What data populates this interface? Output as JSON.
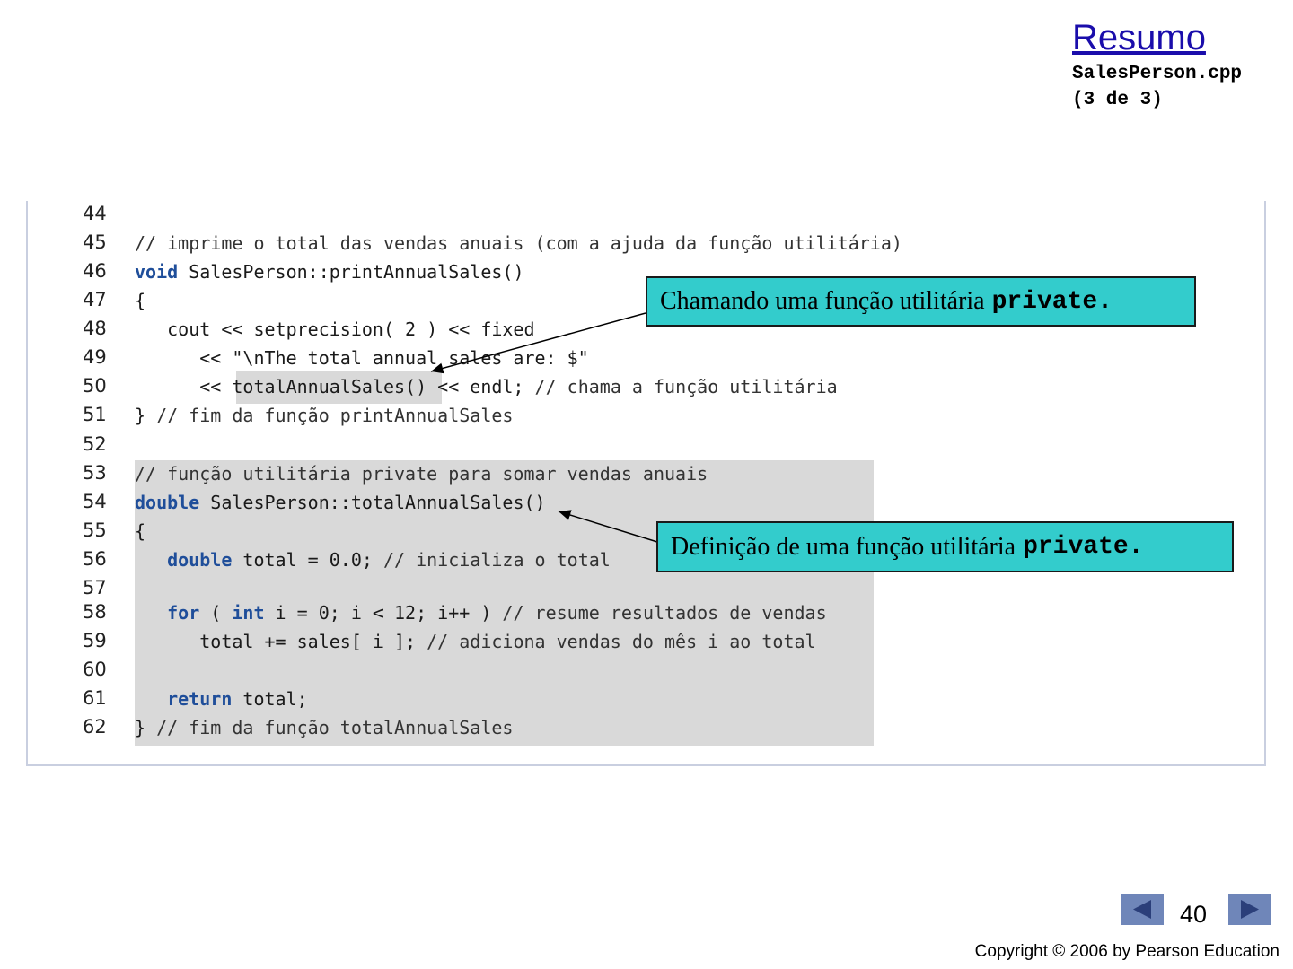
{
  "header": {
    "link_label": "Resumo",
    "file_name": "SalesPerson.cpp",
    "page_of": "(3 de 3)"
  },
  "code": {
    "lines": [
      {
        "num": "44",
        "text": ""
      },
      {
        "num": "45",
        "text": "// imprime o total das vendas anuais (com a ajuda da função utilitária)"
      },
      {
        "num": "46",
        "text": "void SalesPerson::printAnnualSales()"
      },
      {
        "num": "47",
        "text": "{"
      },
      {
        "num": "48",
        "text": "   cout << setprecision( 2 ) << fixed"
      },
      {
        "num": "49",
        "text": "      << \"\\nThe total annual sales are: $\""
      },
      {
        "num": "50",
        "text": "      << totalAnnualSales() << endl; // chama a função utilitária"
      },
      {
        "num": "51",
        "text": "} // fim da função printAnnualSales"
      },
      {
        "num": "52",
        "text": ""
      },
      {
        "num": "53",
        "text": "// função utilitária private para somar vendas anuais"
      },
      {
        "num": "54",
        "text": "double SalesPerson::totalAnnualSales()"
      },
      {
        "num": "55",
        "text": "{"
      },
      {
        "num": "56",
        "text": "   double total = 0.0; // inicializa o total"
      },
      {
        "num": "57",
        "text": ""
      },
      {
        "num": "58",
        "text": "   for ( int i = 0; i < 12; i++ ) // resume resultados de vendas"
      },
      {
        "num": "59",
        "text": "      total += sales[ i ]; // adiciona vendas do mês i ao total"
      },
      {
        "num": "60",
        "text": ""
      },
      {
        "num": "61",
        "text": "   return total;"
      },
      {
        "num": "62",
        "text": "} // fim da função totalAnnualSales"
      }
    ]
  },
  "callouts": {
    "first": {
      "text": "Chamando uma função utilitária",
      "code": "private."
    },
    "second": {
      "text": "Definição de uma função utilitária",
      "code": "private."
    }
  },
  "footer": {
    "page_number": "40",
    "copyright": "Copyright © 2006 by Pearson Education"
  },
  "colors": {
    "callout_bg": "#33cccc",
    "highlight": "#d9d9d9",
    "keyword": "#1f4e9a",
    "nav_button": "#6f86b9",
    "link": "#1a0dab"
  }
}
